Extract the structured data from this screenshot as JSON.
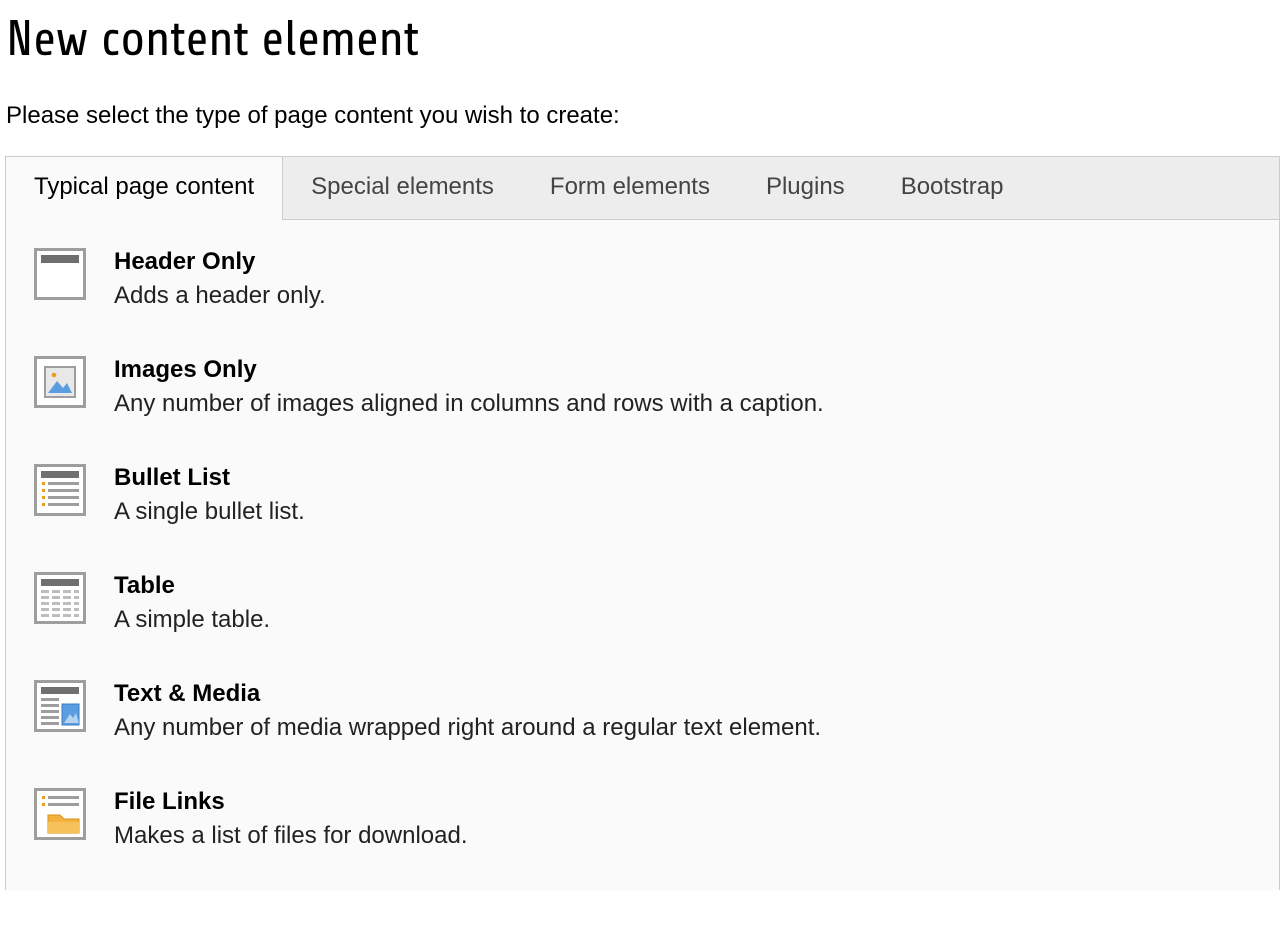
{
  "heading": "New content element",
  "intro": "Please select the type of page content you wish to create:",
  "tabs": [
    {
      "label": "Typical page content",
      "active": true
    },
    {
      "label": "Special elements",
      "active": false
    },
    {
      "label": "Form elements",
      "active": false
    },
    {
      "label": "Plugins",
      "active": false
    },
    {
      "label": "Bootstrap",
      "active": false
    }
  ],
  "items": [
    {
      "icon": "header-only-icon",
      "title": "Header Only",
      "desc": "Adds a header only."
    },
    {
      "icon": "images-only-icon",
      "title": "Images Only",
      "desc": "Any number of images aligned in columns and rows with a caption."
    },
    {
      "icon": "bullet-list-icon",
      "title": "Bullet List",
      "desc": "A single bullet list."
    },
    {
      "icon": "table-icon",
      "title": "Table",
      "desc": "A simple table."
    },
    {
      "icon": "text-media-icon",
      "title": "Text & Media",
      "desc": "Any number of media wrapped right around a regular text element."
    },
    {
      "icon": "file-links-icon",
      "title": "File Links",
      "desc": "Makes a list of files for download."
    }
  ]
}
